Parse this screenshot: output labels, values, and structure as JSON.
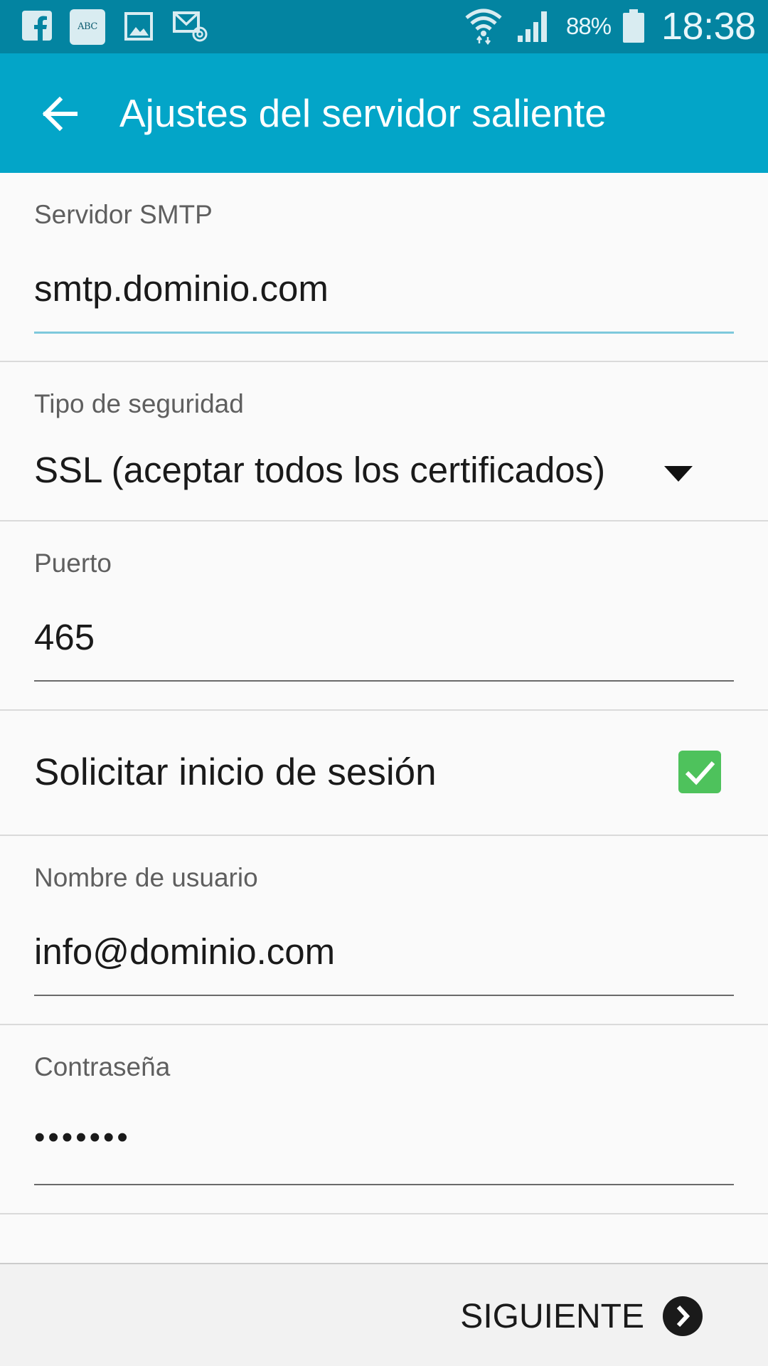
{
  "status_bar": {
    "battery_percent": "88%",
    "time": "18:38",
    "abc_icon_text": "ABC",
    "icons": [
      "facebook-icon",
      "abc-icon",
      "gallery-icon",
      "email-icon",
      "wifi-icon",
      "signal-icon",
      "battery-icon"
    ],
    "colors": {
      "background": "#0384a1"
    }
  },
  "app_bar": {
    "title": "Ajustes del servidor saliente",
    "back_icon": "arrow-left-icon",
    "colors": {
      "background": "#03a5c8"
    }
  },
  "form": {
    "smtp_server": {
      "label": "Servidor SMTP",
      "value": "smtp.dominio.com"
    },
    "security_type": {
      "label": "Tipo de seguridad",
      "value": "SSL (aceptar todos los certificados)"
    },
    "port": {
      "label": "Puerto",
      "value": "465"
    },
    "require_login": {
      "label": "Solicitar inicio de sesión",
      "checked": true
    },
    "username": {
      "label": "Nombre de usuario",
      "value": "info@dominio.com"
    },
    "password": {
      "label": "Contraseña",
      "value": "•••••••"
    }
  },
  "bottom_bar": {
    "next_label": "SIGUIENTE",
    "next_icon": "chevron-right-circle-icon"
  },
  "colors": {
    "checkbox": "#4ec25c",
    "active_underline": "#7ec9dc"
  }
}
